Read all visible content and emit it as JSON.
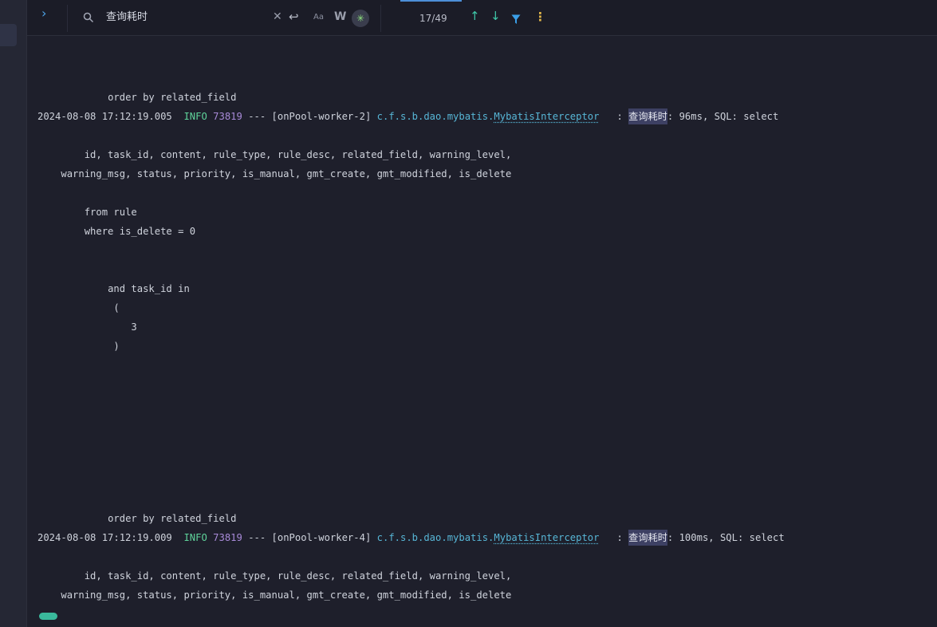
{
  "toolbar": {
    "search_query": "查询耗时",
    "match_counter": "17/49",
    "icons": [
      "chevron-right-icon",
      "search-icon",
      "clear-icon",
      "enter-icon",
      "match-case-icon",
      "whole-word-icon",
      "regex-icon",
      "arrow-up-icon",
      "arrow-down-icon",
      "filter-icon",
      "more-icon"
    ],
    "case_label": "Aa",
    "word_label": "W"
  },
  "log": {
    "lines": [
      {
        "indent": "            ",
        "text": "order by related_field"
      },
      {
        "timestamp": "2024-08-08 17:12:19.005",
        "level": "INFO",
        "pid": "73819",
        "dashes": "---",
        "thread": "[onPool-worker-2]",
        "logger_pkg": "c.f.s.b.dao.mybatis.",
        "logger_class": "MybatisInterceptor",
        "colon": ":",
        "match": "查询耗时",
        "rest": ": 96ms, SQL: select"
      },
      {
        "indent": "        ",
        "text": "id, task_id, content, rule_type, rule_desc, related_field, warning_level,"
      },
      {
        "indent": "    ",
        "text": "warning_msg, status, priority, is_manual, gmt_create, gmt_modified, is_delete"
      },
      {
        "indent": "        ",
        "text": "from rule"
      },
      {
        "indent": "        ",
        "text": "where is_delete = 0"
      },
      {
        "indent": "            ",
        "text": "and task_id in"
      },
      {
        "indent": "             ",
        "text": "("
      },
      {
        "indent": "                ",
        "text": "3"
      },
      {
        "indent": "             ",
        "text": ")"
      },
      {
        "indent": "            ",
        "text": "order by related_field"
      },
      {
        "timestamp": "2024-08-08 17:12:19.009",
        "level": "INFO",
        "pid": "73819",
        "dashes": "---",
        "thread": "[onPool-worker-4]",
        "logger_pkg": "c.f.s.b.dao.mybatis.",
        "logger_class": "MybatisInterceptor",
        "colon": ":",
        "match": "查询耗时",
        "rest": ": 100ms, SQL: select"
      },
      {
        "indent": "        ",
        "text": "id, task_id, content, rule_type, rule_desc, related_field, warning_level,"
      },
      {
        "indent": "    ",
        "text": "warning_msg, status, priority, is_manual, gmt_create, gmt_modified, is_delete"
      }
    ]
  },
  "colors": {
    "background": "#1e1f2b",
    "info": "#5fd49b",
    "pid": "#a98bd9",
    "logger": "#57b6d6",
    "highlight": "#3d4063",
    "accent": "#4c8fd8"
  }
}
